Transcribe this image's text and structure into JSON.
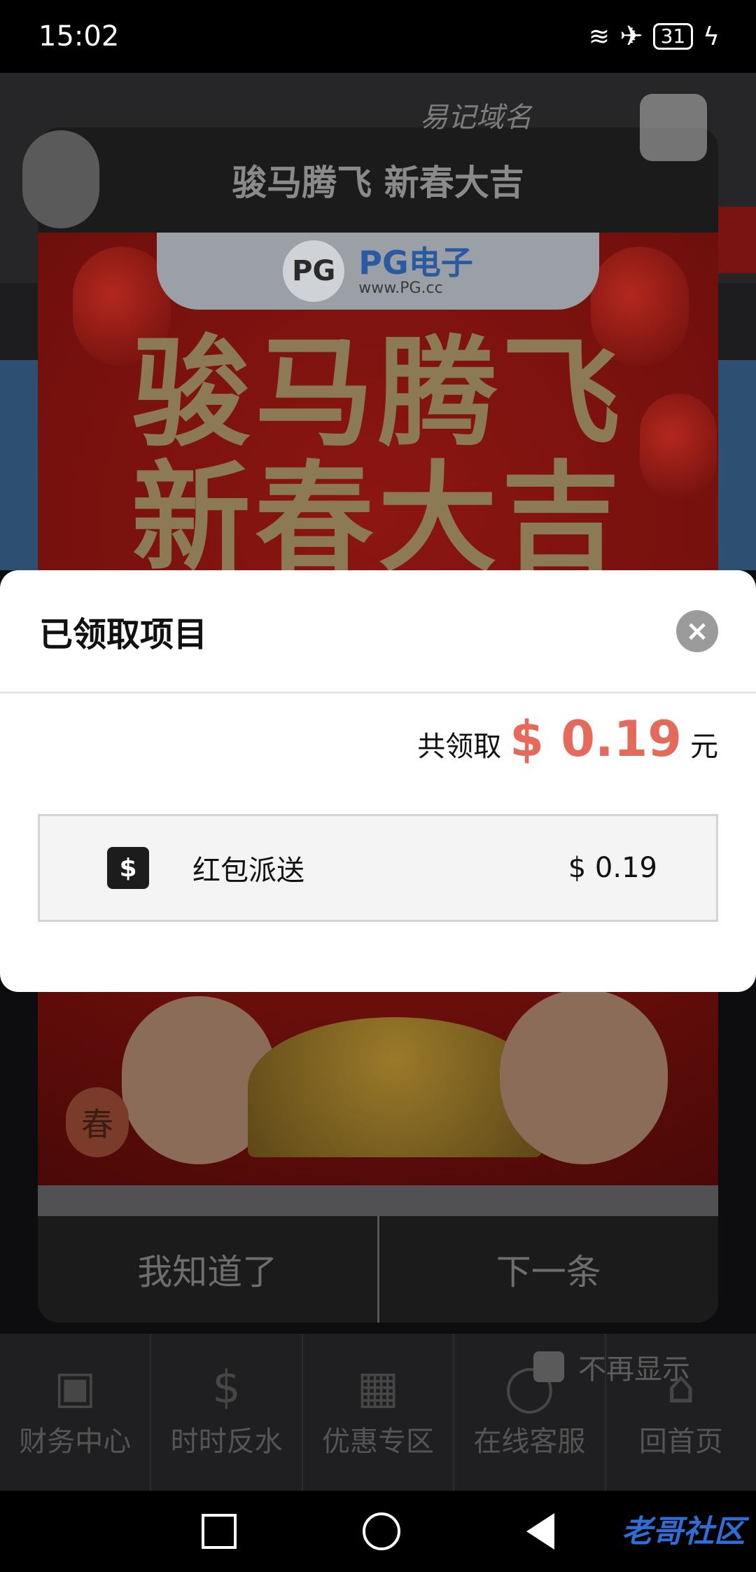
{
  "status_bar": {
    "time": "15:02",
    "battery": "31"
  },
  "background": {
    "domain_hint": "易记域名",
    "tabs": [
      {
        "label": "财务中心",
        "icon": "money-icon"
      },
      {
        "label": "时时反水",
        "icon": "dollar-icon"
      },
      {
        "label": "优惠专区",
        "icon": "gift-icon"
      },
      {
        "label": "在线客服",
        "icon": "chat-icon"
      },
      {
        "label": "回首页",
        "icon": "home-icon"
      }
    ]
  },
  "notice": {
    "title": "骏马腾飞 新春大吉",
    "poster": {
      "brand": "PG电子",
      "brand_url": "www.PG.cc",
      "headline_line1": "骏马腾飞",
      "headline_line2": "新春大吉",
      "chun": "春"
    },
    "ok_label": "我知道了",
    "next_label": "下一条",
    "dont_show_label": "不再显示"
  },
  "modal": {
    "title": "已领取项目",
    "total_label": "共领取",
    "total_amount": "$ 0.19",
    "total_unit": "元",
    "items": [
      {
        "name": "红包派送",
        "amount": "$ 0.19"
      }
    ]
  },
  "watermark": "老哥社区"
}
